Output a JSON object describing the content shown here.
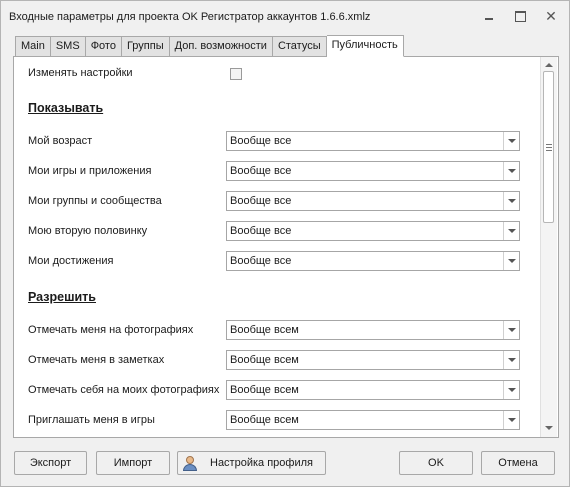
{
  "window": {
    "title": "Входные параметры для проекта OK Регистратор аккаунтов 1.6.6.xmlz",
    "close_glyph": "✕"
  },
  "tabs": [
    {
      "label": "Main"
    },
    {
      "label": "SMS"
    },
    {
      "label": "Фото"
    },
    {
      "label": "Группы"
    },
    {
      "label": "Доп. возможности"
    },
    {
      "label": "Статусы"
    },
    {
      "label": "Публичность",
      "active": true
    }
  ],
  "settings": {
    "change_label": "Изменять настройки",
    "change_checked": false
  },
  "show_section": {
    "title": "Показывать",
    "rows": [
      {
        "label": "Мой возраст",
        "value": "Вообще все"
      },
      {
        "label": "Мои игры и приложения",
        "value": "Вообще все"
      },
      {
        "label": "Мои группы и сообщества",
        "value": "Вообще все"
      },
      {
        "label": "Мою вторую половинку",
        "value": "Вообще все"
      },
      {
        "label": "Мои достижения",
        "value": "Вообще все"
      }
    ]
  },
  "allow_section": {
    "title": "Разрешить",
    "rows": [
      {
        "label": "Отмечать меня на фотографиях",
        "value": "Вообще всем"
      },
      {
        "label": "Отмечать меня в заметках",
        "value": "Вообще всем"
      },
      {
        "label": "Отмечать себя на моих фотографиях",
        "value": "Вообще всем"
      },
      {
        "label": "Приглашать меня в игры",
        "value": "Вообще всем"
      }
    ]
  },
  "buttons": {
    "export": "Экспорт",
    "import": "Импорт",
    "profile": "Настройка профиля",
    "ok": "OK",
    "cancel": "Отмена"
  },
  "icons": {
    "profile_button": "person-icon",
    "combo_arrow": "chevron-down-icon"
  }
}
